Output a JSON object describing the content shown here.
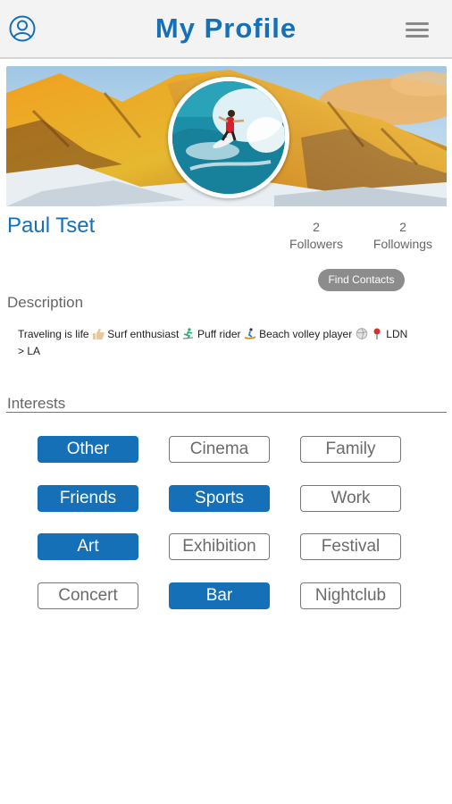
{
  "header": {
    "title": "My Profile",
    "user_icon": "user-circle-icon",
    "menu_icon": "hamburger-menu-icon"
  },
  "profile": {
    "name": "Paul Tset",
    "followers_count": "2",
    "followers_label": "Followers",
    "followings_count": "2",
    "followings_label": "Followings",
    "find_contacts_label": "Find Contacts"
  },
  "description": {
    "label": "Description",
    "parts": [
      "Traveling is life",
      "Surf enthusiast",
      "Puff rider",
      "Beach volley player",
      "LDN",
      "> LA"
    ]
  },
  "interests": {
    "label": "Interests",
    "items": [
      {
        "label": "Other",
        "selected": true
      },
      {
        "label": "Cinema",
        "selected": false
      },
      {
        "label": "Family",
        "selected": false
      },
      {
        "label": "Friends",
        "selected": true
      },
      {
        "label": "Sports",
        "selected": true
      },
      {
        "label": "Work",
        "selected": false
      },
      {
        "label": "Art",
        "selected": true
      },
      {
        "label": "Exhibition",
        "selected": false
      },
      {
        "label": "Festival",
        "selected": false
      },
      {
        "label": "Concert",
        "selected": false
      },
      {
        "label": "Bar",
        "selected": true
      },
      {
        "label": "Nightclub",
        "selected": false
      }
    ]
  },
  "colors": {
    "accent": "#1670b8",
    "button_gray": "#8c8c8c"
  }
}
